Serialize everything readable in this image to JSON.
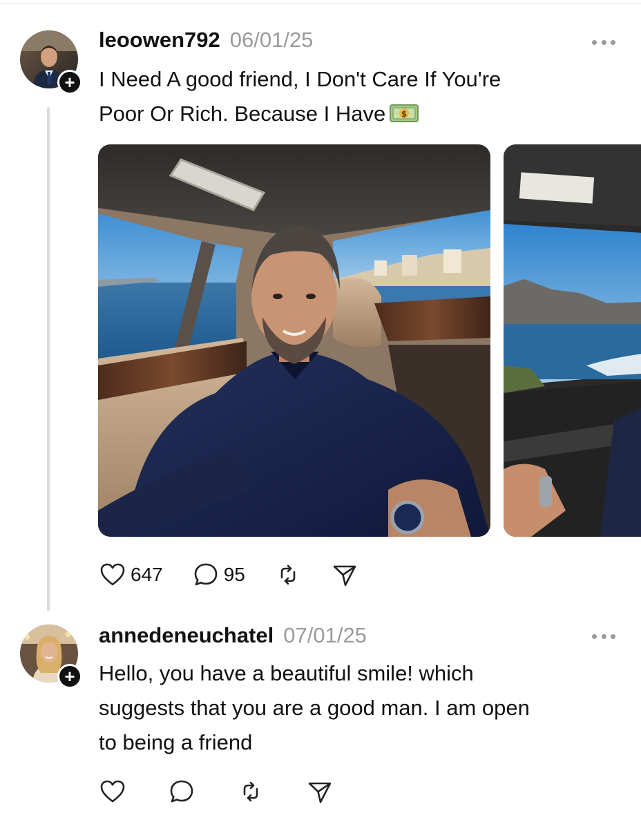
{
  "posts": [
    {
      "username": "leoowen792",
      "date": "06/01/25",
      "text_line1": "I Need A good friend, I Don't Care If You're",
      "text_line2": "Poor Or Rich. Because I Have",
      "emoji": "money-with-dollar-sign",
      "likes": "647",
      "comments": "95",
      "media": [
        {
          "description": "selfie of a smiling man in a navy shirt in a car backseat, sea view through windows"
        },
        {
          "description": "car interior with ocean and mountain view through window"
        }
      ]
    },
    {
      "username": "annedeneuchatel",
      "date": "07/01/25",
      "text_line1": "Hello, you have a beautiful smile! which",
      "text_line2": "suggests that you are a good man. I am open",
      "text_line3": "to being a friend"
    }
  ],
  "icons": {
    "like": "heart-icon",
    "comment": "comment-bubble-icon",
    "repost": "repost-icon",
    "share": "send-icon",
    "more": "more-icon",
    "follow": "plus-icon"
  },
  "colors": {
    "text": "#111111",
    "meta": "#9a9a9a",
    "thread_line": "#dcdcdc"
  }
}
